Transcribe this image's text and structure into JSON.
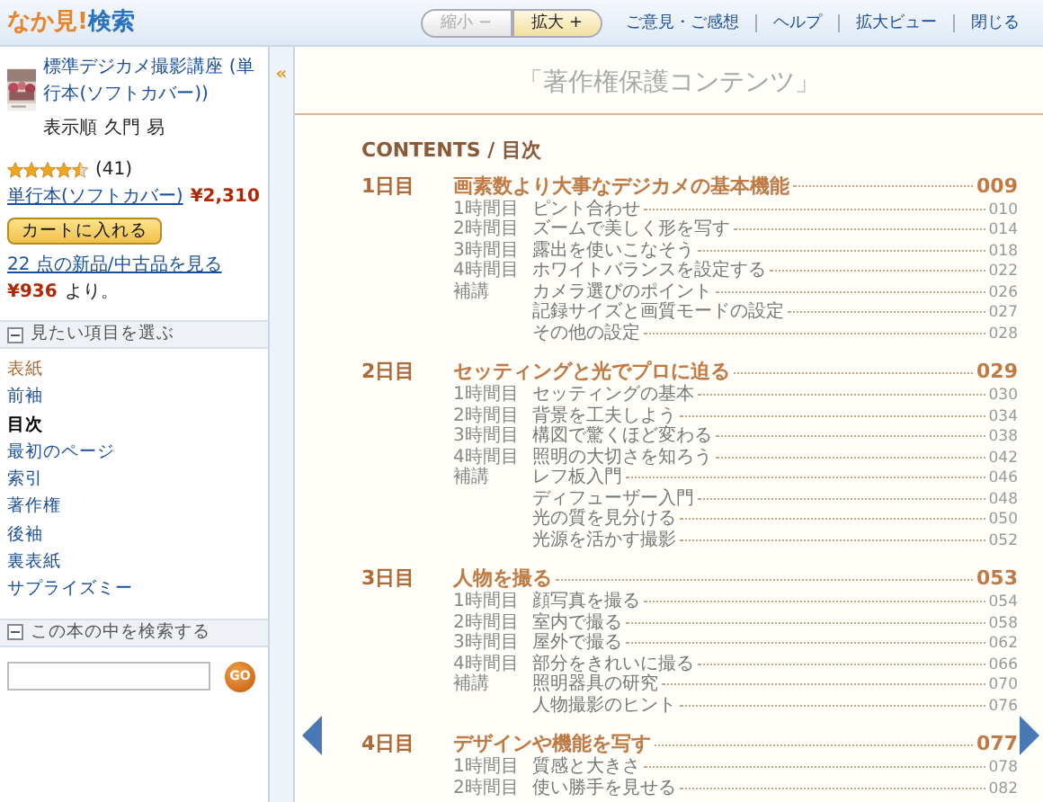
{
  "header": {
    "logo_brand": "なか見!",
    "logo_word": "検索"
  },
  "toolbar": {
    "zoom_buttons": [
      {
        "label": "縮小 −",
        "disabled": true
      },
      {
        "label": "拡大 +",
        "disabled": false
      }
    ],
    "links": [
      "ご意見・ご感想",
      "ヘルプ",
      "拡大ビュー",
      "閉じる"
    ]
  },
  "book": {
    "title": "標準デジカメ撮影講座 (単行本(ソフトカバー))",
    "author_label": "表示順",
    "author": "久門 易",
    "stars": 4.5,
    "rating_count": "(41)",
    "format": "単行本(ソフトカバー)",
    "price": "¥2,310",
    "cart_button": "カートに入れる",
    "offers_link": "22 点の新品/中古品を見る",
    "offers_price": "¥936",
    "offers_suffix": "より。"
  },
  "sections_panel": {
    "title": "見たい項目を選ぶ",
    "expanded": true,
    "items": [
      {
        "label": "表紙",
        "selected": false,
        "visited": true
      },
      {
        "label": "前袖",
        "selected": false,
        "visited": false
      },
      {
        "label": "目次",
        "selected": true,
        "visited": false
      },
      {
        "label": "最初のページ",
        "selected": false,
        "visited": false
      },
      {
        "label": "索引",
        "selected": false,
        "visited": false
      },
      {
        "label": "著作権",
        "selected": false,
        "visited": false
      },
      {
        "label": "後袖",
        "selected": false,
        "visited": false
      },
      {
        "label": "裏表紙",
        "selected": false,
        "visited": false
      },
      {
        "label": "サプライズミー",
        "selected": false,
        "visited": false
      }
    ]
  },
  "search_panel": {
    "title": "この本の中を検索する",
    "expanded": true,
    "go_button": "GO"
  },
  "collapse_toggle": "«",
  "page": {
    "protected_note": "「著作権保護コンテンツ」",
    "heading": "CONTENTS / 目次",
    "chapters": [
      {
        "day": "1日目",
        "title": "画素数より大事なデジカメの基本機能",
        "page": "009",
        "lessons": [
          {
            "label": "1時間目",
            "title": "ピント合わせ",
            "page": "010"
          },
          {
            "label": "2時間目",
            "title": "ズームで美しく形を写す",
            "page": "014"
          },
          {
            "label": "3時間目",
            "title": "露出を使いこなそう",
            "page": "018"
          },
          {
            "label": "4時間目",
            "title": "ホワイトバランスを設定する",
            "page": "022"
          },
          {
            "label": "補講",
            "title": "カメラ選びのポイント",
            "page": "026"
          },
          {
            "title": "記録サイズと画質モードの設定",
            "page": "027"
          },
          {
            "title": "その他の設定",
            "page": "028"
          }
        ]
      },
      {
        "day": "2日目",
        "title": "セッティングと光でプロに迫る",
        "page": "029",
        "lessons": [
          {
            "label": "1時間目",
            "title": "セッティングの基本",
            "page": "030"
          },
          {
            "label": "2時間目",
            "title": "背景を工夫しよう",
            "page": "034"
          },
          {
            "label": "3時間目",
            "title": "構図で驚くほど変わる",
            "page": "038"
          },
          {
            "label": "4時間目",
            "title": "照明の大切さを知ろう",
            "page": "042"
          },
          {
            "label": "補講",
            "title": "レフ板入門",
            "page": "046"
          },
          {
            "title": "ディフューザー入門",
            "page": "048"
          },
          {
            "title": "光の質を見分ける",
            "page": "050"
          },
          {
            "title": "光源を活かす撮影",
            "page": "052"
          }
        ]
      },
      {
        "day": "3日目",
        "title": "人物を撮る",
        "page": "053",
        "lessons": [
          {
            "label": "1時間目",
            "title": "顔写真を撮る",
            "page": "054"
          },
          {
            "label": "2時間目",
            "title": "室内で撮る",
            "page": "058"
          },
          {
            "label": "3時間目",
            "title": "屋外で撮る",
            "page": "062"
          },
          {
            "label": "4時間目",
            "title": "部分をきれいに撮る",
            "page": "066"
          },
          {
            "label": "補講",
            "title": "照明器具の研究",
            "page": "070"
          },
          {
            "title": "人物撮影のヒント",
            "page": "076"
          }
        ]
      },
      {
        "day": "4日目",
        "title": "デザインや機能を写す",
        "page": "077",
        "lessons": [
          {
            "label": "1時間目",
            "title": "質感と大きさ",
            "page": "078"
          },
          {
            "label": "2時間目",
            "title": "使い勝手を見せる",
            "page": "082"
          }
        ]
      }
    ]
  }
}
